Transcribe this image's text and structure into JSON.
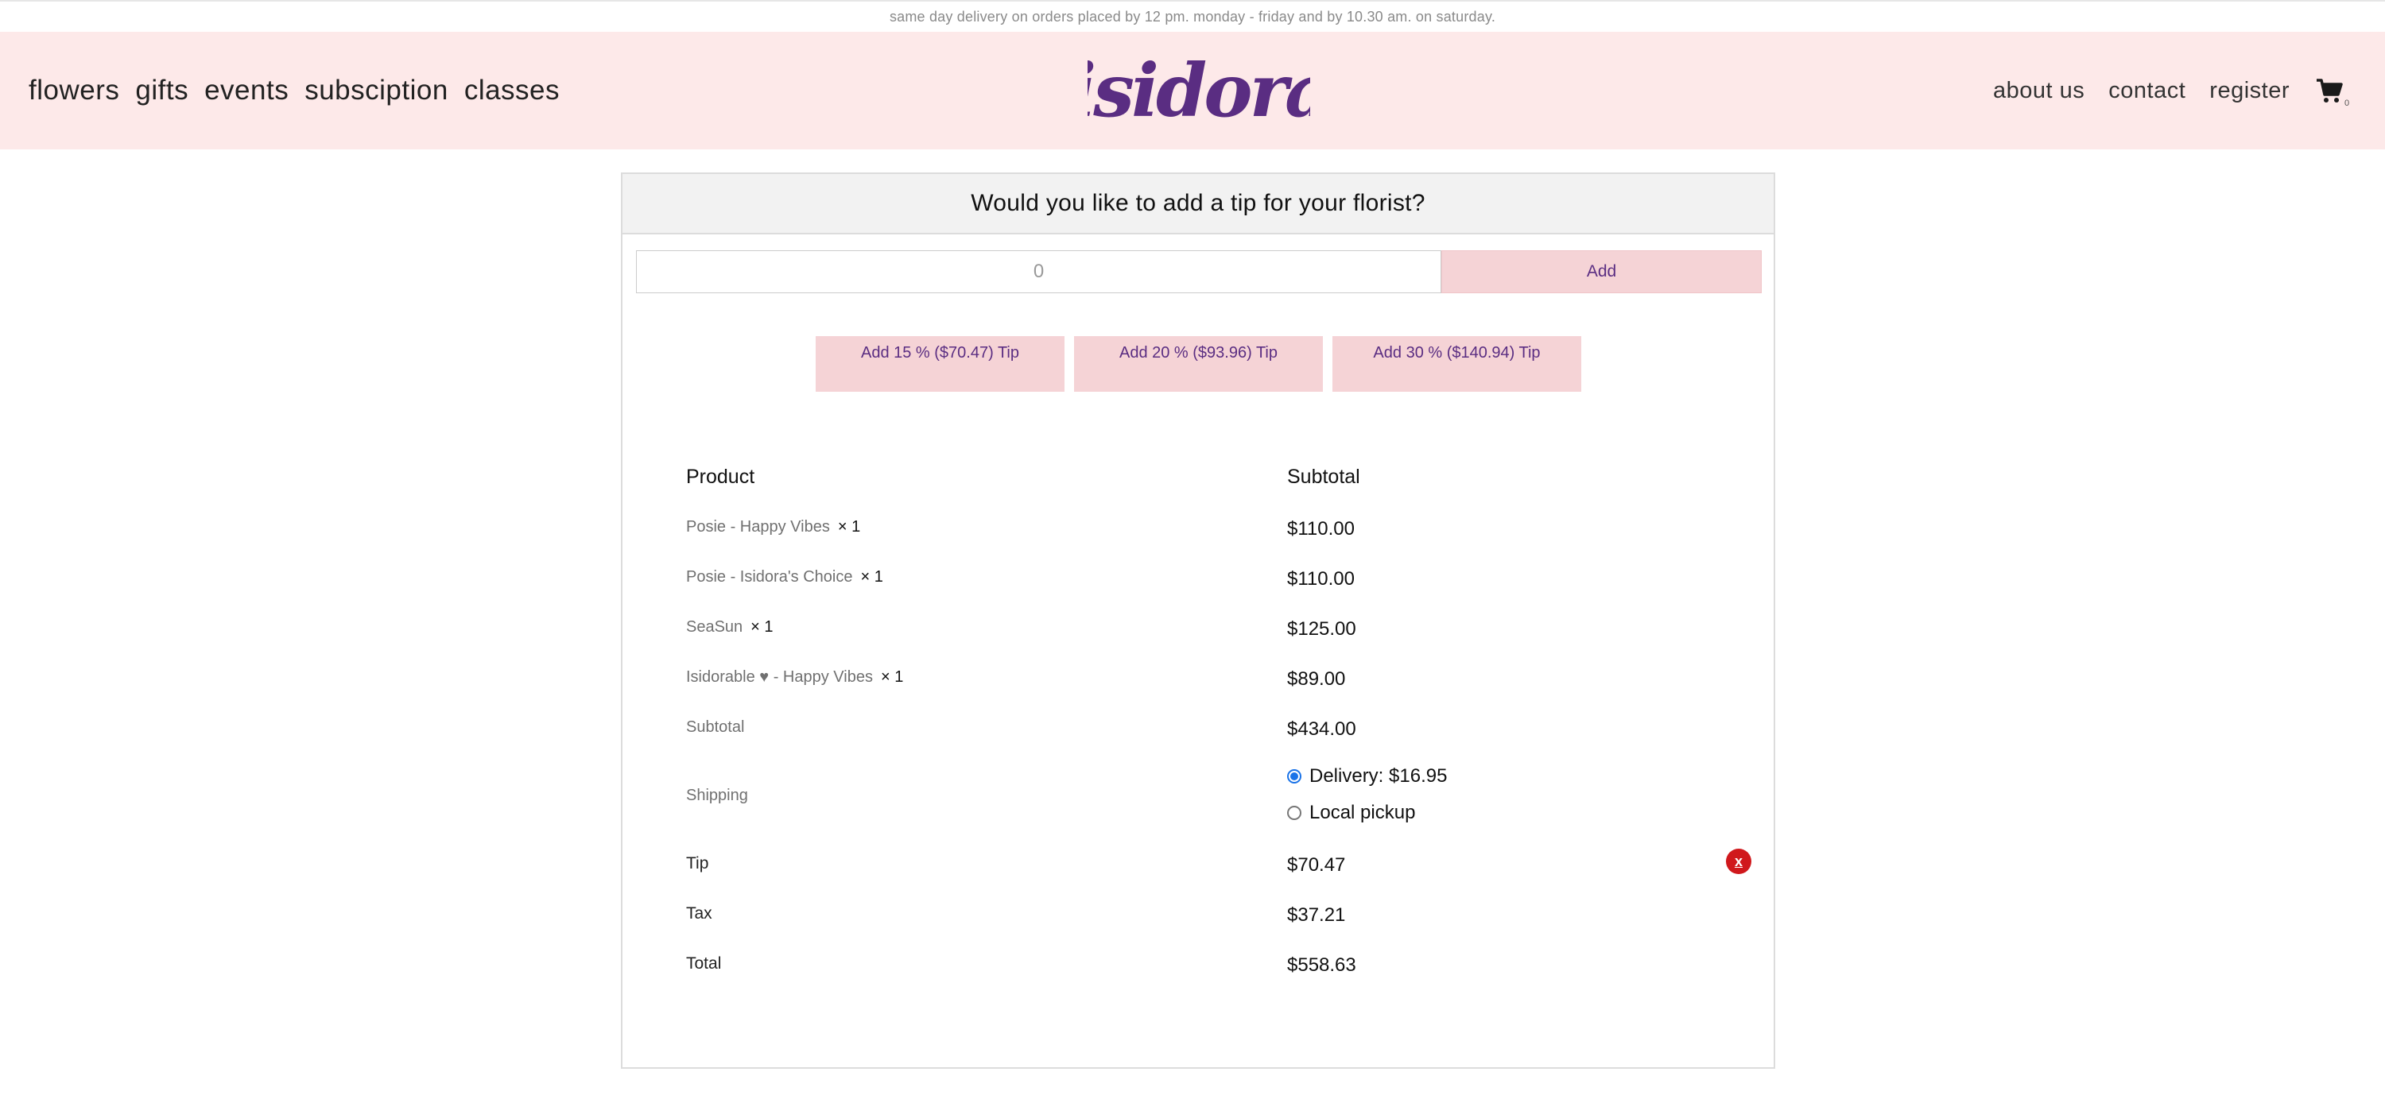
{
  "announcement": "same day delivery on orders placed by 12 pm. monday - friday and by 10.30 am. on saturday.",
  "nav": {
    "left": [
      "flowers",
      "gifts",
      "events",
      "subsciption",
      "classes"
    ],
    "right": [
      "about us",
      "contact",
      "register"
    ],
    "cart_count": "0"
  },
  "logo_text": "isidora",
  "tip_panel": {
    "title": "Would you like to add a tip for your florist?",
    "input_value": "0",
    "add_label": "Add",
    "presets": [
      "Add 15 % ($70.47) Tip",
      "Add 20 % ($93.96) Tip",
      "Add 30 % ($140.94) Tip"
    ]
  },
  "order": {
    "header": {
      "product": "Product",
      "subtotal": "Subtotal"
    },
    "items": [
      {
        "name": "Posie - Happy Vibes",
        "qty": "× 1",
        "price": "$110.00"
      },
      {
        "name": "Posie - Isidora's Choice",
        "qty": "× 1",
        "price": "$110.00"
      },
      {
        "name": "SeaSun",
        "qty": "× 1",
        "price": "$125.00"
      },
      {
        "name": "Isidorable ♥ - Happy Vibes",
        "qty": "× 1",
        "price": "$89.00"
      }
    ],
    "subtotal_label": "Subtotal",
    "subtotal_value": "$434.00",
    "shipping_label": "Shipping",
    "shipping_options": [
      {
        "label": "Delivery: $16.95",
        "selected": true
      },
      {
        "label": "Local pickup",
        "selected": false
      }
    ],
    "tip_label": "Tip",
    "tip_value": "$70.47",
    "tip_remove": "x",
    "tax_label": "Tax",
    "tax_value": "$37.21",
    "total_label": "Total",
    "total_value": "$558.63"
  },
  "colors": {
    "header_bg": "#fde9e9",
    "button_bg": "#f5d3d6",
    "brand_purple": "#5a2d82",
    "remove_red": "#d0181c"
  }
}
